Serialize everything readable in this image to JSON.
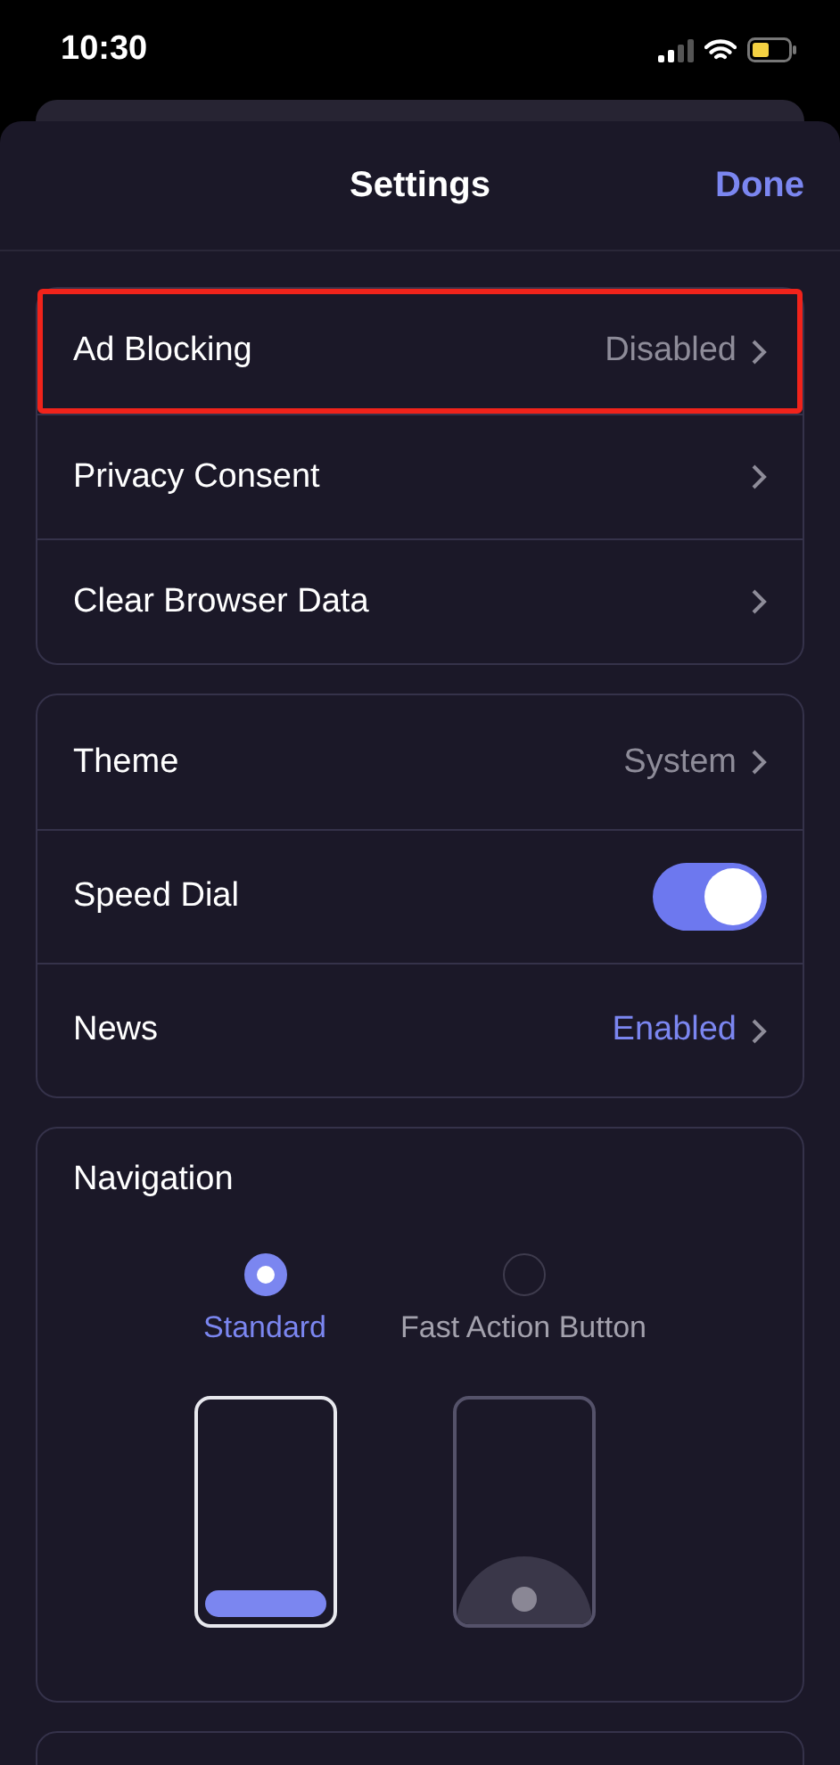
{
  "status_bar": {
    "time": "10:30"
  },
  "header": {
    "title": "Settings",
    "done": "Done"
  },
  "groups": [
    {
      "rows": [
        {
          "kind": "link",
          "label": "Ad Blocking",
          "value": "Disabled",
          "accent": false,
          "highlighted": true
        },
        {
          "kind": "link",
          "label": "Privacy Consent",
          "highlighted": false
        },
        {
          "kind": "link",
          "label": "Clear Browser Data",
          "highlighted": false
        }
      ]
    },
    {
      "rows": [
        {
          "kind": "link",
          "label": "Theme",
          "value": "System",
          "accent": false,
          "highlighted": false
        },
        {
          "kind": "toggle",
          "label": "Speed Dial",
          "on": true,
          "highlighted": false
        },
        {
          "kind": "link",
          "label": "News",
          "value": "Enabled",
          "accent": true,
          "highlighted": false
        }
      ]
    }
  ],
  "navigation": {
    "title": "Navigation",
    "options": [
      {
        "label": "Standard",
        "kind": "bar",
        "selected": true
      },
      {
        "label": "Fast Action Button",
        "kind": "fab",
        "selected": false
      }
    ]
  }
}
